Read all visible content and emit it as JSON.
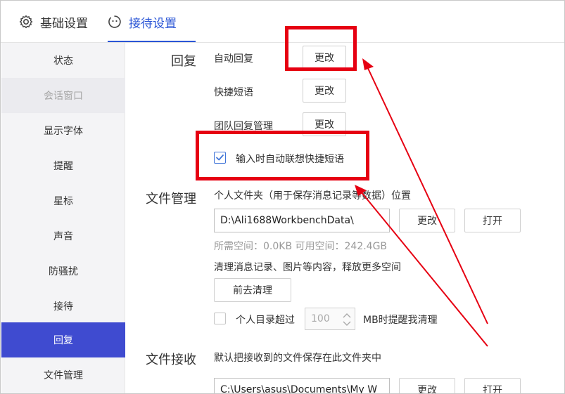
{
  "tabs": [
    {
      "label": "基础设置",
      "icon": "gear-icon"
    },
    {
      "label": "接待设置",
      "icon": "reception-face-icon",
      "active": true
    }
  ],
  "sidebar": {
    "items": [
      {
        "label": "状态"
      },
      {
        "label": "会话窗口",
        "state": "disabled"
      },
      {
        "label": "显示字体"
      },
      {
        "label": "提醒"
      },
      {
        "label": "星标"
      },
      {
        "label": "声音"
      },
      {
        "label": "防骚扰"
      },
      {
        "label": "接待"
      },
      {
        "label": "回复",
        "state": "active"
      },
      {
        "label": "文件管理"
      }
    ]
  },
  "reply": {
    "section_title": "回复",
    "auto_reply_label": "自动回复",
    "auto_reply_button": "更改",
    "quick_phrase_label": "快捷短语",
    "quick_phrase_button": "更改",
    "team_reply_label": "团队回复管理",
    "team_reply_button": "更改",
    "auto_suggest_label": "输入时自动联想快捷短语",
    "auto_suggest_checked": true
  },
  "file_management": {
    "section_title": "文件管理",
    "personal_folder_label": "个人文件夹（用于保存消息记录等数据）位置",
    "path_value": "D:\\Ali1688WorkbenchData\\",
    "change_button": "更改",
    "open_button": "打开",
    "space_info": "所需空间：0.0KB   可用空间：242.4GB",
    "cleanup_desc": "清理消息记录、图片等内容，释放更多空间",
    "cleanup_button": "前去清理",
    "dir_exceed_label": "个人目录超过",
    "dir_exceed_value": "100",
    "dir_exceed_suffix": "MB时提醒我清理",
    "dir_exceed_checked": false
  },
  "file_receive": {
    "section_title": "文件接收",
    "desc": "默认把接收到的文件保存在此文件夹中",
    "path_value": "C:\\Users\\asus\\Documents\\My W",
    "change_button": "更改",
    "open_button": "打开"
  },
  "colors": {
    "accent": "#2b56d6",
    "sidebar_active": "#3f4bd0",
    "annotation_red": "#e60012"
  }
}
